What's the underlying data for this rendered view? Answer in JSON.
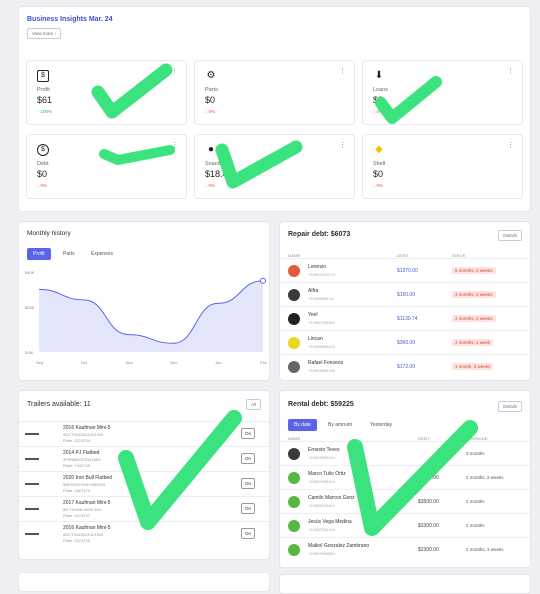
{
  "insights": {
    "title": "Business Insights Mar. 24",
    "view_more": "View more",
    "metrics": [
      {
        "label": "Profit",
        "value": "$61",
        "change": "100%",
        "dir": "up",
        "icon": "dollar-bill-icon"
      },
      {
        "label": "Parts",
        "value": "$0",
        "change": "0%",
        "dir": "down",
        "icon": "gears-icon"
      },
      {
        "label": "Loans",
        "value": "$0",
        "change": "0%",
        "dir": "down",
        "icon": "download-icon"
      },
      {
        "label": "Debt",
        "value": "$0",
        "change": "0%",
        "dir": "down",
        "icon": "dollar-circle-icon"
      },
      {
        "label": "Snack",
        "value": "$18.4",
        "change": "0%",
        "dir": "down",
        "icon": "snack-icon"
      },
      {
        "label": "Shell",
        "value": "$0",
        "change": "0%",
        "dir": "down",
        "icon": "shell-icon"
      }
    ]
  },
  "history": {
    "title": "Monthly history",
    "tabs": [
      "Profit",
      "Parts",
      "Expenses"
    ],
    "y_labels": [
      "$40K",
      "$20K",
      "$-6K"
    ],
    "x_labels": [
      "Sep",
      "Oct",
      "Nov",
      "Dec",
      "Jan",
      "Feb"
    ]
  },
  "chart_data": {
    "type": "area",
    "title": "Monthly history",
    "categories": [
      "Sep",
      "Oct",
      "Nov",
      "Dec",
      "Jan",
      "Feb"
    ],
    "series": [
      {
        "values": [
          30,
          24,
          4,
          -1,
          22,
          35
        ]
      }
    ],
    "ylim": [
      -6,
      40
    ]
  },
  "repair": {
    "title": "Repair debt: $6073",
    "details": "Details",
    "headers": [
      "NAME",
      "DEBT",
      "SINCE"
    ],
    "rows": [
      {
        "name": "Lorenzo",
        "phone": "+15592302273",
        "debt": "$1370.00",
        "since": "5 months, 2 weeks",
        "avatar": "#e25a3c"
      },
      {
        "name": "Alfra",
        "phone": "+15598855111",
        "debt": "$150.00",
        "since": "3 months, 2 weeks",
        "avatar": "#3a3a3a"
      },
      {
        "name": "Yeel",
        "phone": "+13980755352",
        "debt": "$1130.74",
        "since": "2 months, 2 weeks",
        "avatar": "#222"
      },
      {
        "name": "Lincan",
        "phone": "+15598869445",
        "debt": "$360.00",
        "since": "2 months, 1 week",
        "avatar": "#e8d81a"
      },
      {
        "name": "Rafael Fonseca",
        "phone": "+15593869198",
        "debt": "$172.00",
        "since": "1 month, 2 weeks",
        "avatar": "#666"
      }
    ]
  },
  "trailers": {
    "title": "Trailers available: 11",
    "all_label": "All",
    "on_label": "On",
    "rows": [
      {
        "name": "2016 Kaufman Mini-5",
        "line1": "5DCT34438G1001503",
        "line2": "Plate: 3274734"
      },
      {
        "name": "2014 PJ Flatbed",
        "line1": "4P5B8890G3314563",
        "line2": "Plate: 7440749"
      },
      {
        "name": "2020 Iron Bull Flatbed",
        "line1": "5BEDDHD29LO355415",
        "line2": "Plate: 3407470"
      },
      {
        "name": "2017 Kaufman Mini-5",
        "line1": "5D:TD443L06H0 334",
        "line2": "Plate: 3274797"
      },
      {
        "name": "2016 Kaufman Mini-5",
        "line1": "5DCT34438G1001503",
        "line2": "Plate: 3274739"
      }
    ]
  },
  "rental": {
    "title": "Rental debt: $59225",
    "details": "Details",
    "tabs": [
      "By date",
      "By amount",
      "Yesterday"
    ],
    "headers": [
      "NAME",
      "DEBT",
      "OVERDUE"
    ],
    "rows": [
      {
        "name": "Ernesto Teves",
        "phone": "+15593982340",
        "debt": "",
        "overdue": "3 months",
        "avatar": "#3a3a3a"
      },
      {
        "name": "Marco Tulio Ortiz",
        "phone": "+15592989494",
        "debt": "$3700.00",
        "overdue": "2 months, 2 weeks",
        "avatar": "#59b843"
      },
      {
        "name": "Camilo Marcos Gonz",
        "phone": "+15598294462",
        "debt": "$3500.00",
        "overdue": "2 months",
        "avatar": "#59b843"
      },
      {
        "name": "Jesús Vega Medina",
        "phone": "+12032254149",
        "debt": "$3300.00",
        "overdue": "2 months",
        "avatar": "#59b843"
      },
      {
        "name": "Maikol Gonzalez Zambrano",
        "phone": "+15597866884",
        "debt": "$2300.00",
        "overdue": "2 months, 3 weeks",
        "avatar": "#59b843"
      }
    ]
  }
}
